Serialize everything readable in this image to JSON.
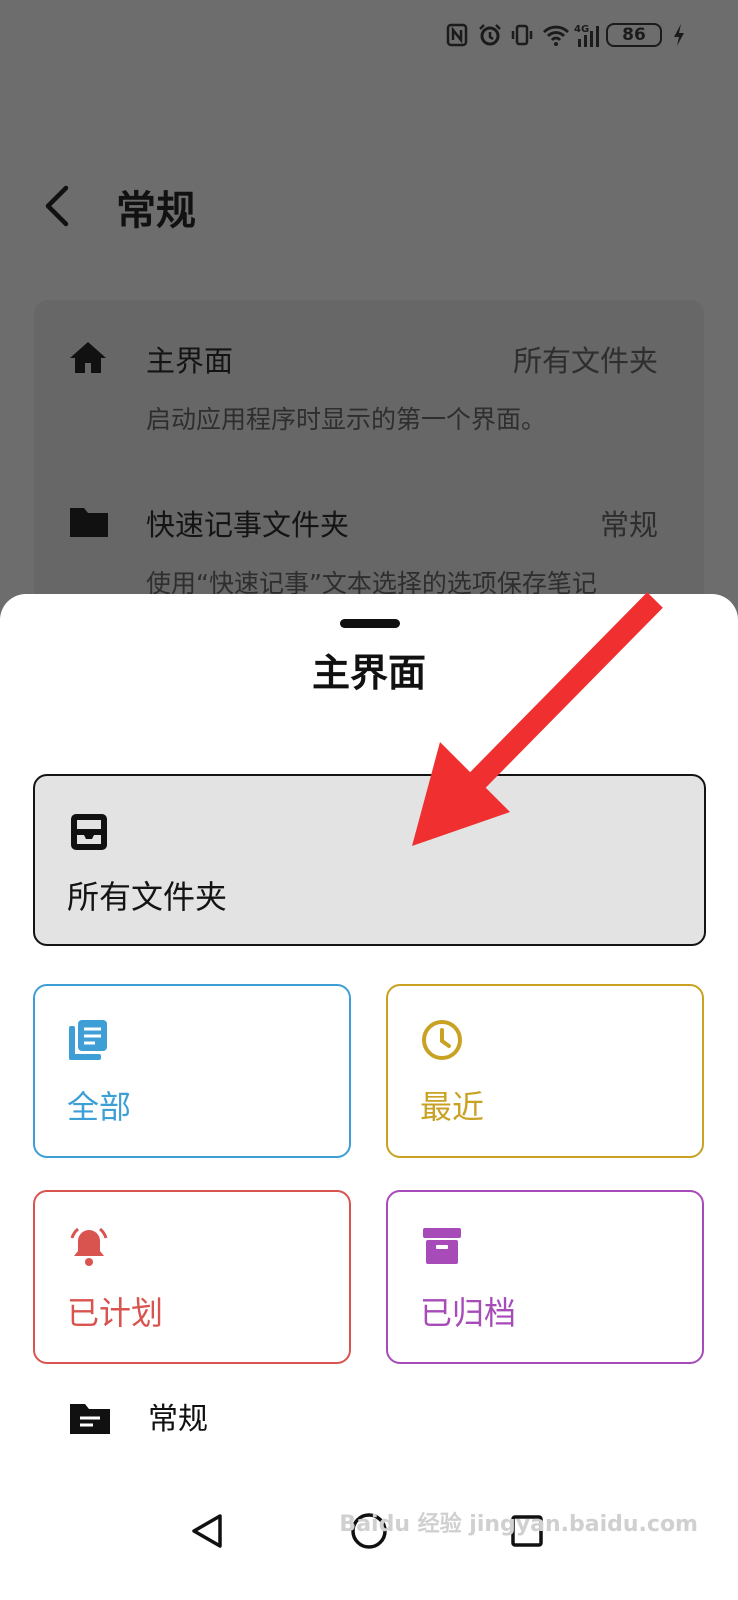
{
  "status_bar": {
    "battery": "86"
  },
  "header": {
    "title": "常规"
  },
  "settings": {
    "items": [
      {
        "title": "主界面",
        "value": "所有文件夹",
        "subtitle": "启动应用程序时显示的第一个界面。"
      },
      {
        "title": "快速记事文件夹",
        "value": "常规",
        "subtitle": "使用“快速记事”文本选择的选项保存笔记"
      }
    ]
  },
  "sheet": {
    "title": "主界面",
    "options": {
      "all_folders": "所有文件夹",
      "all": "全部",
      "recent": "最近",
      "scheduled": "已计划",
      "archived": "已归档"
    },
    "folder": "常规"
  },
  "watermark": "Baidu 经验 jingyan.baidu.com",
  "colors": {
    "all": "#3d9fd6",
    "recent": "#c9a224",
    "scheduled": "#d9534f",
    "archived": "#a64bb8",
    "arrow": "#f03030"
  }
}
